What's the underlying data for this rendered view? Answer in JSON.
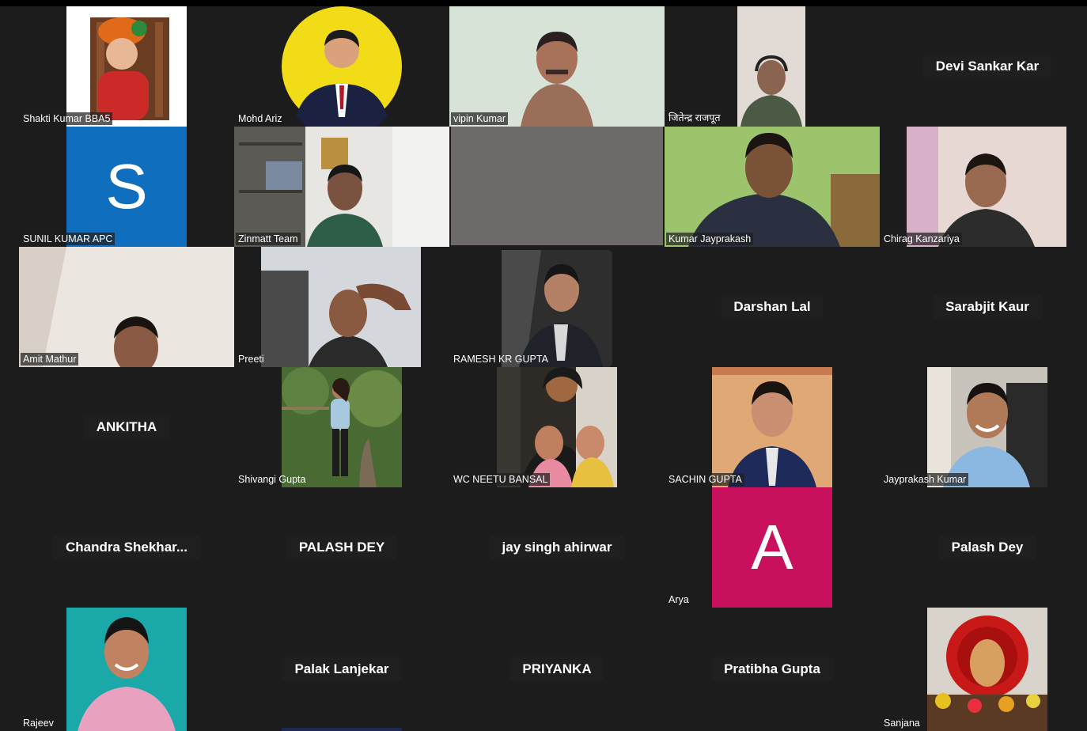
{
  "participants": [
    {
      "name": "Shakti Kumar BBA5",
      "avatar_color": "#c8341f"
    },
    {
      "name": "Mohd Ariz",
      "avatar_color": "#f2dc17"
    },
    {
      "name": "vipin Kumar"
    },
    {
      "name": "जितेन्द्र राजपूत"
    },
    {
      "name": "Devi Sankar Kar"
    },
    {
      "name": "SUNIL KUMAR APC",
      "avatar_letter": "S",
      "avatar_color": "#106ebe"
    },
    {
      "name": "Zinmatt Team"
    },
    {
      "name": ""
    },
    {
      "name": "Kumar Jayprakash"
    },
    {
      "name": "Chirag Kanzariya"
    },
    {
      "name": "Amit Mathur"
    },
    {
      "name": "Preeti"
    },
    {
      "name": "RAMESH KR GUPTA"
    },
    {
      "name": "Darshan Lal"
    },
    {
      "name": "Sarabjit Kaur"
    },
    {
      "name": "ANKITHA"
    },
    {
      "name": "Shivangi Gupta"
    },
    {
      "name": "WC NEETU BANSAL"
    },
    {
      "name": "SACHIN GUPTA"
    },
    {
      "name": "Jayprakash Kumar"
    },
    {
      "name": "Chandra  Shekhar..."
    },
    {
      "name": "PALASH DEY"
    },
    {
      "name": "jay singh ahirwar"
    },
    {
      "name": "Arya",
      "avatar_letter": "A",
      "avatar_color": "#c8105c"
    },
    {
      "name": "Palash Dey"
    },
    {
      "name": "Rajeev"
    },
    {
      "name": "Palak Lanjekar"
    },
    {
      "name": "PRIYANKA"
    },
    {
      "name": "Pratibha Gupta"
    },
    {
      "name": "Sanjana"
    }
  ]
}
